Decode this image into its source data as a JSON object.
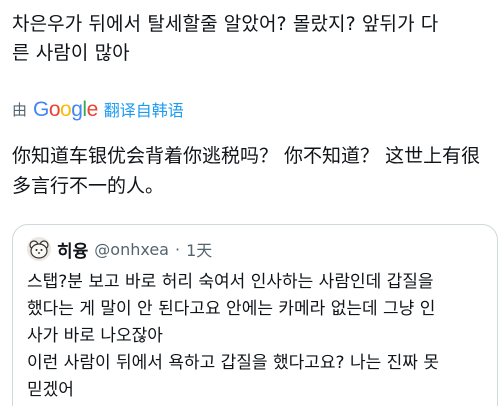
{
  "post": {
    "text": "차은우가 뒤에서 탈세할줄 알았어? 몰랐지? 앞뒤가 다\n른 사람이 많아"
  },
  "translation": {
    "by_label": "由",
    "provider": "Google",
    "action_label": "翻译自韩语",
    "text": "你知道车银优会背着你逃税吗？ 你不知道？ 这世上有很\n多言行不一的人。"
  },
  "quote": {
    "display_name": "히융",
    "handle": "@onhxea",
    "separator": "·",
    "time": "1天",
    "text": "스탭?분 보고 바로 허리 숙여서 인사하는 사람인데 갑질을\n했다는 게 말이 안 된다고요 안에는 카메라 없는데 그냥 인\n사가 바로 나오잖아\n이런 사람이 뒤에서 욕하고 갑질을 했다고요? 나는 진짜 못\n믿겠어"
  },
  "colors": {
    "text_primary": "#0f1419",
    "text_secondary": "#536471",
    "link_blue": "#1d9bf0",
    "border": "#cfd9de"
  },
  "icons": {
    "avatar": "bear-avatar-icon",
    "google": "google-logo-icon"
  }
}
